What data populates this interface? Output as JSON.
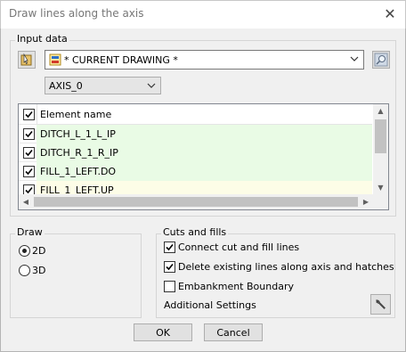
{
  "window": {
    "title": "Draw lines along the axis",
    "close_glyph": "✕"
  },
  "input_data": {
    "legend": "Input data",
    "drawing_combo": {
      "value": "* CURRENT DRAWING *"
    },
    "axis_combo": {
      "value": "AXIS_0"
    }
  },
  "elements": {
    "header": "Element name",
    "rows": [
      {
        "name": "DITCH_L_1_L_IP",
        "checked": true,
        "bg": "#e9fbe5"
      },
      {
        "name": "DITCH_R_1_R_IP",
        "checked": true,
        "bg": "#e9fbe5"
      },
      {
        "name": "FILL_1_LEFT.DO",
        "checked": true,
        "bg": "#e9fbe5"
      },
      {
        "name": "FILL_1_LEFT.UP",
        "checked": true,
        "bg": "#fdfde7"
      }
    ]
  },
  "draw": {
    "legend": "Draw",
    "options": [
      {
        "label": "2D",
        "selected": true
      },
      {
        "label": "3D",
        "selected": false
      }
    ]
  },
  "cuts_fills": {
    "legend": "Cuts and fills",
    "checkboxes": [
      {
        "label": "Connect cut and fill lines",
        "checked": true
      },
      {
        "label": "Delete existing lines along axis and hatches",
        "checked": true
      },
      {
        "label": "Embankment Boundary",
        "checked": false
      }
    ],
    "additional_settings": "Additional Settings"
  },
  "buttons": {
    "ok": "OK",
    "cancel": "Cancel"
  },
  "colors": {
    "row_green": "#e9fbe5",
    "row_yellow": "#fdfde7",
    "scroll_thumb": "#c2c2c2"
  }
}
